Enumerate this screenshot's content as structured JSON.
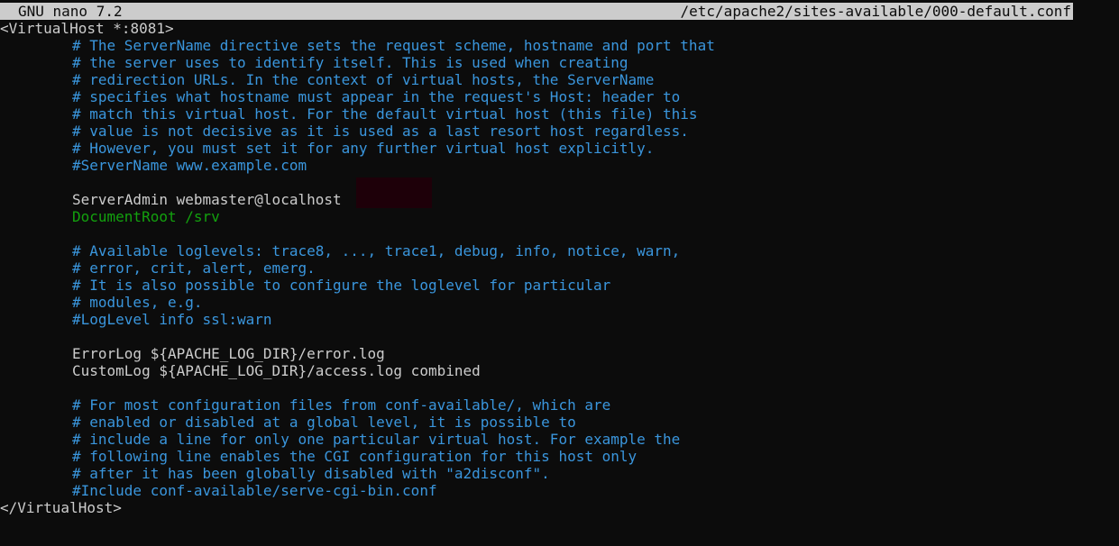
{
  "titlebar": {
    "app": "GNU nano 7.2",
    "file": "/etc/apache2/sites-available/000-default.conf"
  },
  "lines": {
    "l1": "<VirtualHost *:8081>",
    "l2": "# The ServerName directive sets the request scheme, hostname and port that",
    "l3": "# the server uses to identify itself. This is used when creating",
    "l4": "# redirection URLs. In the context of virtual hosts, the ServerName",
    "l5": "# specifies what hostname must appear in the request's Host: header to",
    "l6": "# match this virtual host. For the default virtual host (this file) this",
    "l7": "# value is not decisive as it is used as a last resort host regardless.",
    "l8": "# However, you must set it for any further virtual host explicitly.",
    "l9": "#ServerName www.example.com",
    "l11": "ServerAdmin webmaster@localhost",
    "l12": "DocumentRoot /srv",
    "l14": "# Available loglevels: trace8, ..., trace1, debug, info, notice, warn,",
    "l15": "# error, crit, alert, emerg.",
    "l16": "# It is also possible to configure the loglevel for particular",
    "l17": "# modules, e.g.",
    "l18": "#LogLevel info ssl:warn",
    "l20": "ErrorLog ${APACHE_LOG_DIR}/error.log",
    "l21": "CustomLog ${APACHE_LOG_DIR}/access.log combined",
    "l23": "# For most configuration files from conf-available/, which are",
    "l24": "# enabled or disabled at a global level, it is possible to",
    "l25": "# include a line for only one particular virtual host. For example the",
    "l26": "# following line enables the CGI configuration for this host only",
    "l27": "# after it has been globally disabled with \"a2disconf\".",
    "l28": "#Include conf-available/serve-cgi-bin.conf",
    "l29": "</VirtualHost>"
  },
  "colors": {
    "background": "#0c0c0c",
    "comment": "#3a96dd",
    "text": "#cccccc",
    "highlight": "#13a10e",
    "titlebar": "#cccccc"
  }
}
